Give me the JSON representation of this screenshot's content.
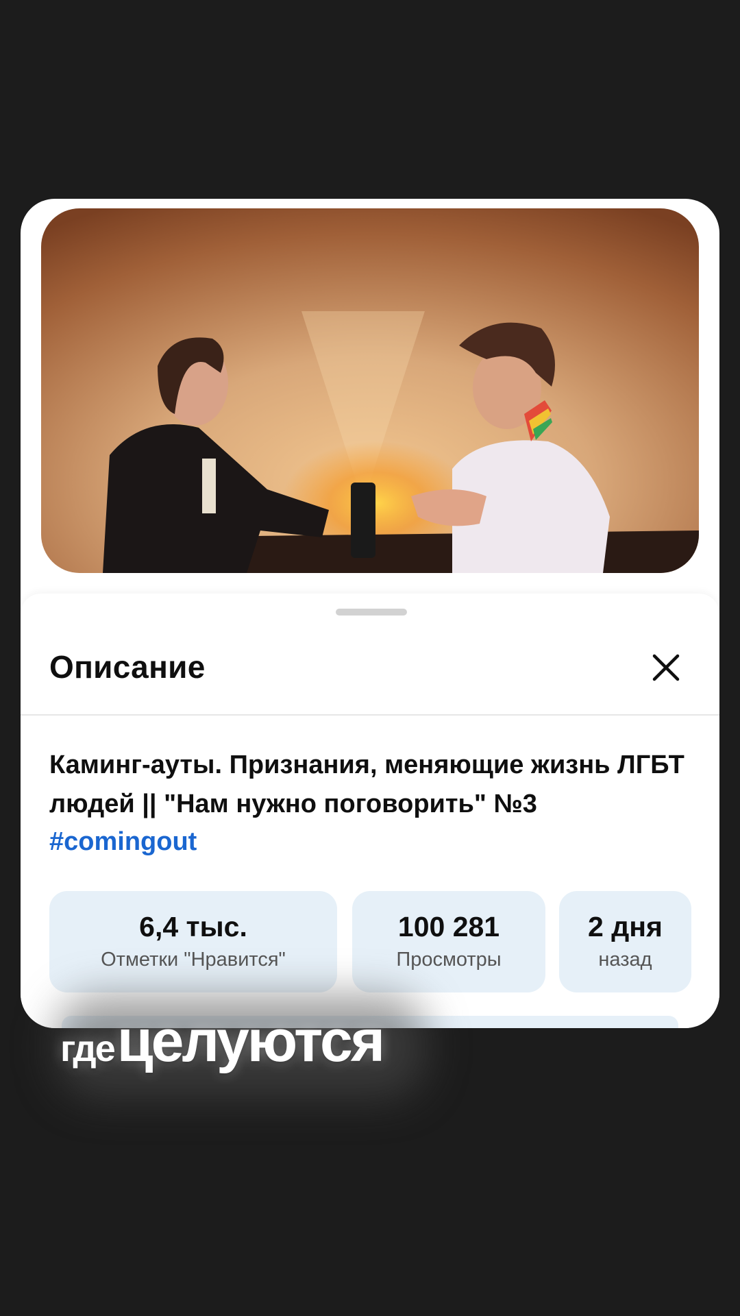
{
  "sheet": {
    "title": "Описание",
    "close_icon": "close-icon"
  },
  "video": {
    "title": "Каминг-ауты. Признания, меняющие жизнь ЛГБТ людей || \"Нам нужно поговорить\" №3",
    "hashtag": "#comingout"
  },
  "stats": {
    "likes_value": "6,4 тыс.",
    "likes_label": "Отметки \"Нравится\"",
    "views_value": "100 281",
    "views_label": "Просмотры",
    "date_value": "2 дня",
    "date_label": "назад"
  },
  "caption": {
    "word1": "где",
    "word2": "целуются"
  },
  "colors": {
    "background": "#1c1c1c",
    "hashtag": "#1a66d0",
    "stat_bg": "#e6f0f8"
  }
}
